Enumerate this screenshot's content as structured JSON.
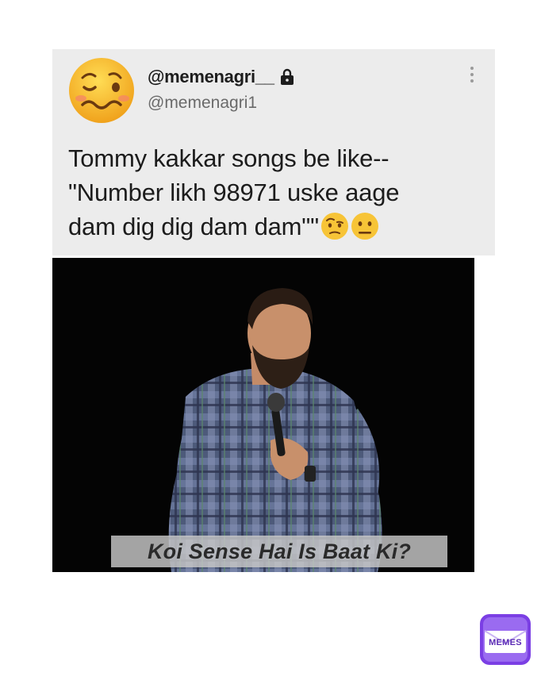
{
  "tweet": {
    "display_name": "@memenagri__",
    "handle": "@memenagri1",
    "text": "Tommy kakkar songs be like--\n\"Number likh 98971 uske aage\ndam dig dig dam dam\"\"",
    "avatar_icon": "woozy-face-emoji",
    "inline_emojis": [
      "face-with-raised-eyebrow-emoji",
      "neutral-face-emoji"
    ]
  },
  "media": {
    "caption": "Koi Sense Hai Is Baat Ki?"
  },
  "watermark": {
    "label": "MEMES",
    "accent": "#7b3fe4"
  }
}
